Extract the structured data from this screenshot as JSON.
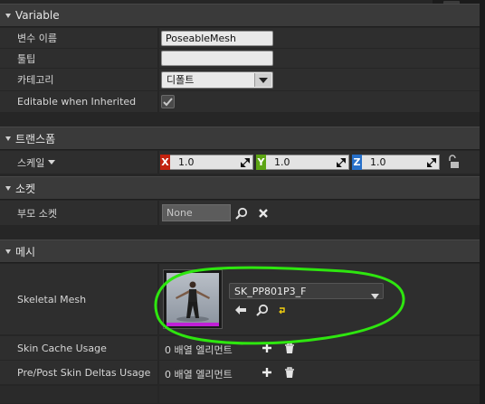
{
  "categories": {
    "variable": "Variable",
    "transform": "트랜스폼",
    "socket": "소켓",
    "mesh": "메시"
  },
  "variable": {
    "name_label": "변수 이름",
    "name_value": "PoseableMesh",
    "tooltip_label": "툴팁",
    "tooltip_value": "",
    "category_label": "카테고리",
    "category_value": "디폴트",
    "editable_label": "Editable when Inherited",
    "editable_checked": true
  },
  "transform": {
    "scale_label": "스케일",
    "x_label": "X",
    "x_value": "1.0",
    "y_label": "Y",
    "y_value": "1.0",
    "z_label": "Z",
    "z_value": "1.0"
  },
  "socket": {
    "parent_label": "부모 소켓",
    "parent_value": "None"
  },
  "mesh": {
    "skeletal_label": "Skeletal Mesh",
    "skeletal_value": "SK_PP801P3_F",
    "skin_cache_label": "Skin Cache Usage",
    "skin_cache_value": "0 배열 엘리먼트",
    "deltas_label": "Pre/Post Skin Deltas Usage",
    "deltas_value": "0 배열 엘리먼트"
  },
  "colors": {
    "x_axis": "#c3220f",
    "y_axis": "#5da514",
    "z_axis": "#2770c9",
    "annotation": "#2ee60f",
    "thumbnail_bar": "#c01fd6"
  }
}
